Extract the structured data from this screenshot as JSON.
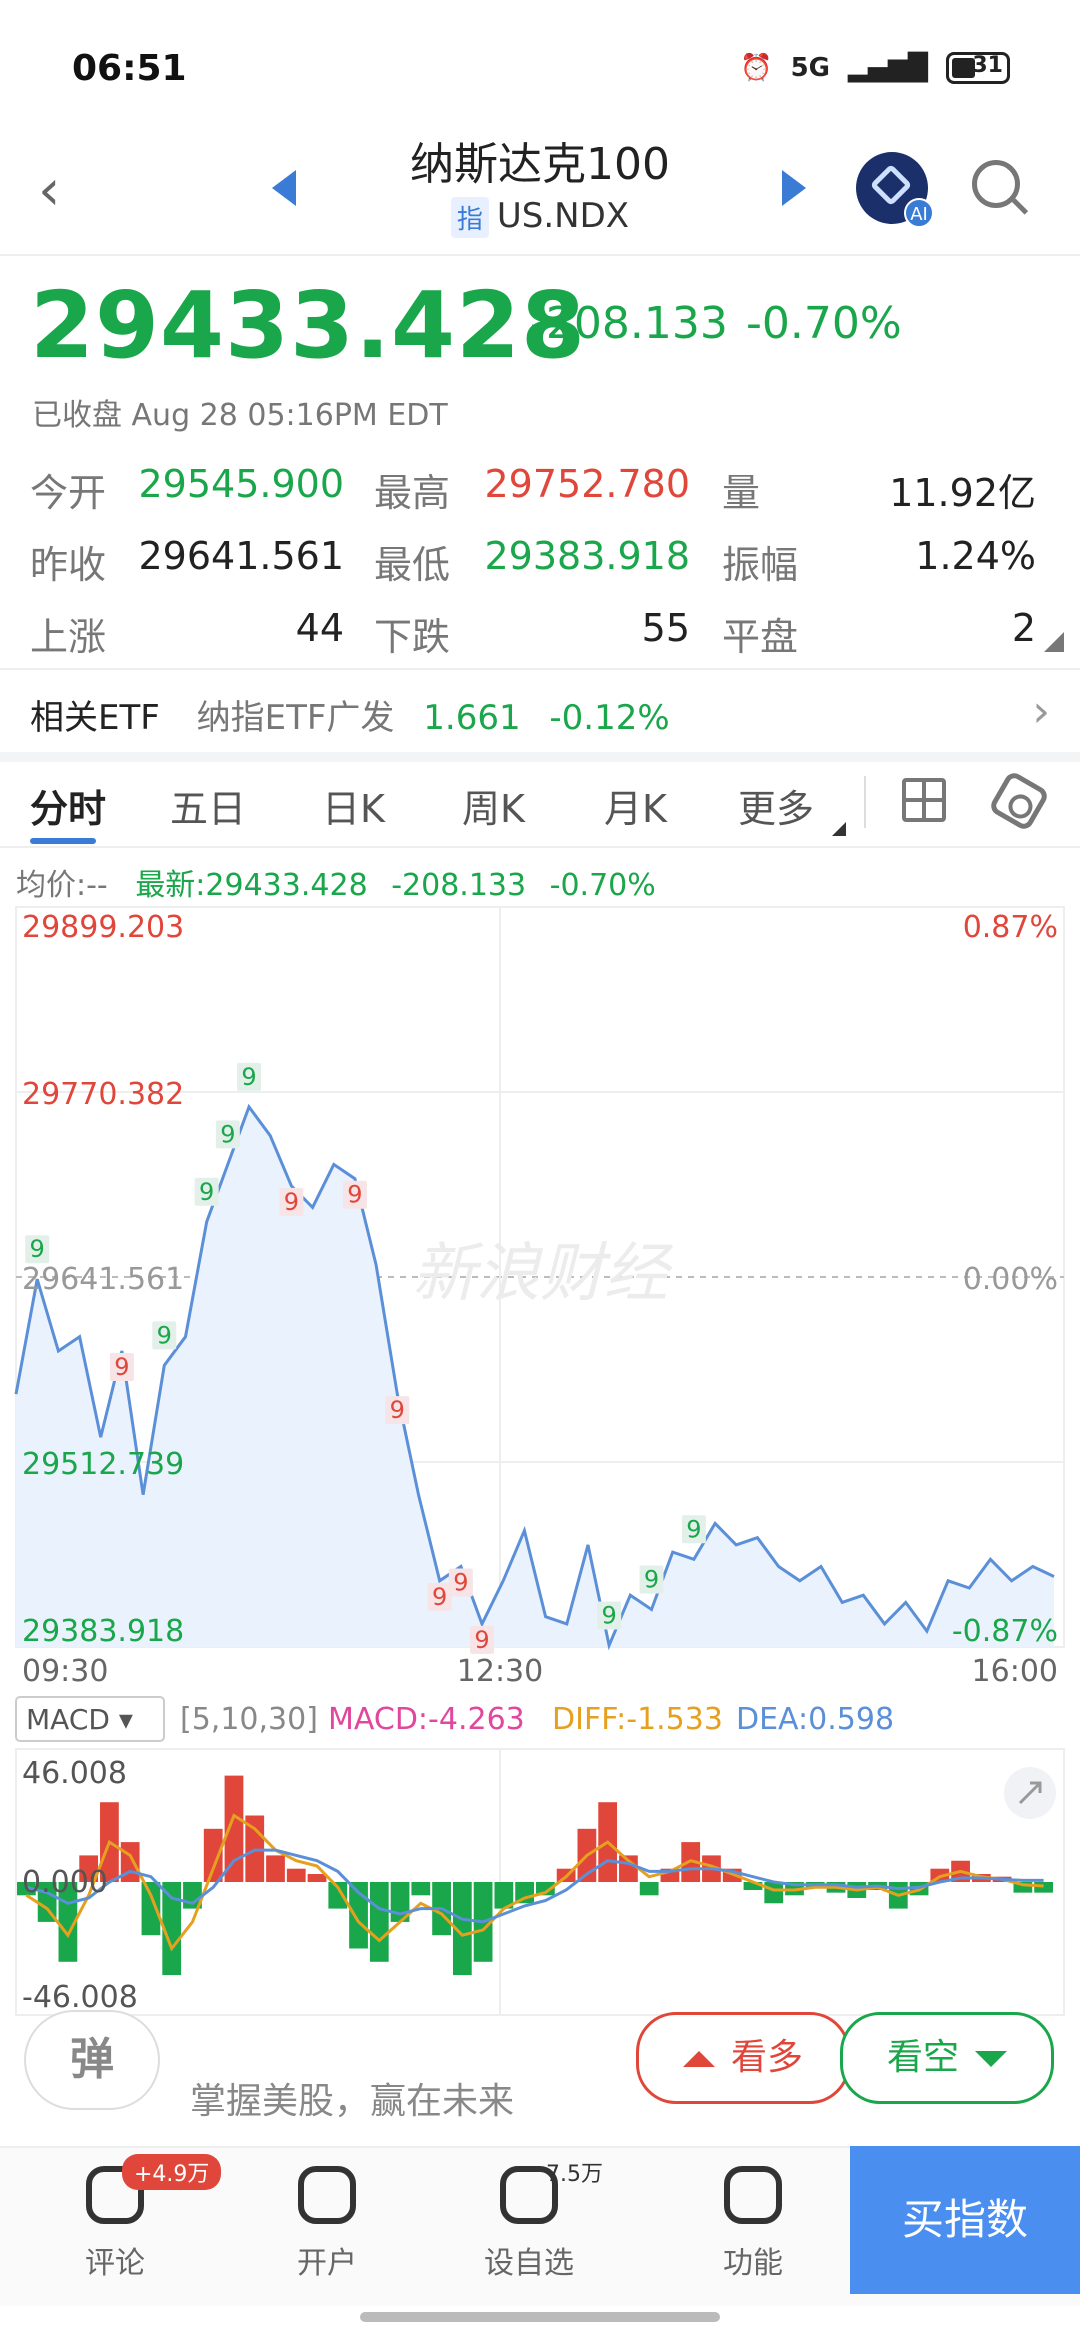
{
  "status": {
    "time": "06:51",
    "network": "5G",
    "battery": "31"
  },
  "header": {
    "title": "纳斯达克100",
    "badge": "指",
    "code": "US.NDX"
  },
  "quote": {
    "price": "29433.428",
    "change": "-208.133",
    "change_pct": "-0.70%",
    "status": "已收盘 Aug 28 05:16PM EDT"
  },
  "stats": {
    "open_label": "今开",
    "open": "29545.900",
    "high_label": "最高",
    "high": "29752.780",
    "volume_label": "量",
    "volume": "11.92亿",
    "prev_label": "昨收",
    "prev": "29641.561",
    "low_label": "最低",
    "low": "29383.918",
    "amp_label": "振幅",
    "amp": "1.24%",
    "up_label": "上涨",
    "up": "44",
    "down_label": "下跌",
    "down": "55",
    "flat_label": "平盘",
    "flat": "2"
  },
  "etf": {
    "label": "相关ETF",
    "name": "纳指ETF广发",
    "price": "1.661",
    "pct": "-0.12%"
  },
  "tabs": [
    "分时",
    "五日",
    "日K",
    "周K",
    "月K",
    "更多"
  ],
  "avg": {
    "label": "均价:--",
    "latest": "最新:29433.428",
    "change": "-208.133",
    "pct": "-0.70%"
  },
  "chart_data": [
    {
      "type": "line",
      "title": "",
      "y_labels_left": [
        "29899.203",
        "29770.382",
        "29641.561",
        "29512.739",
        "29383.918"
      ],
      "y_labels_right": [
        "0.87%",
        "0.00%",
        "-0.87%"
      ],
      "x_labels": [
        "09:30",
        "12:30",
        "16:00"
      ],
      "ylim": [
        29383.918,
        29899.203
      ],
      "watermark": "新浪财经",
      "series": [
        {
          "values": [
            29560,
            29640,
            29590,
            29600,
            29530,
            29590,
            29490,
            29580,
            29600,
            29680,
            29720,
            29760,
            29740,
            29705,
            29690,
            29720,
            29710,
            29650,
            29560,
            29490,
            29430,
            29440,
            29400,
            29430,
            29465,
            29405,
            29400,
            29455,
            29385,
            29420,
            29410,
            29450,
            29445,
            29470,
            29455,
            29460,
            29440,
            29430,
            29440,
            29415,
            29420,
            29400,
            29415,
            29395,
            29430,
            29425,
            29445,
            29430,
            29440,
            29433
          ]
        }
      ],
      "tags": [
        {
          "i": 1,
          "label": "9",
          "color": "green"
        },
        {
          "i": 5,
          "label": "9",
          "color": "red"
        },
        {
          "i": 7,
          "label": "9",
          "color": "green"
        },
        {
          "i": 9,
          "label": "9",
          "color": "green"
        },
        {
          "i": 10,
          "label": "9",
          "color": "green"
        },
        {
          "i": 11,
          "label": "9",
          "color": "green"
        },
        {
          "i": 13,
          "label": "9",
          "color": "red"
        },
        {
          "i": 16,
          "label": "9",
          "color": "red"
        },
        {
          "i": 18,
          "label": "9",
          "color": "red"
        },
        {
          "i": 20,
          "label": "9",
          "color": "red"
        },
        {
          "i": 21,
          "label": "9",
          "color": "red"
        },
        {
          "i": 22,
          "label": "9",
          "color": "red"
        },
        {
          "i": 28,
          "label": "9",
          "color": "green"
        },
        {
          "i": 30,
          "label": "9",
          "color": "green"
        },
        {
          "i": 32,
          "label": "9",
          "color": "green"
        }
      ]
    },
    {
      "type": "bar",
      "title": "MACD",
      "params": "[5,10,30]",
      "macd_label": "MACD:-4.263",
      "diff_label": "DIFF:-1.533",
      "dea_label": "DEA:0.598",
      "y_labels": [
        "46.008",
        "0.000",
        "-46.008"
      ],
      "ylim": [
        -46.008,
        46.008
      ],
      "values": [
        -5,
        -15,
        -30,
        10,
        30,
        15,
        -20,
        -35,
        -10,
        20,
        40,
        25,
        10,
        5,
        3,
        -10,
        -25,
        -30,
        -15,
        -5,
        -20,
        -35,
        -30,
        -10,
        -8,
        -5,
        5,
        20,
        30,
        10,
        -5,
        5,
        15,
        10,
        5,
        -3,
        -8,
        -5,
        -2,
        -4,
        -6,
        -3,
        -10,
        -5,
        5,
        8,
        3,
        2,
        -4,
        -4
      ],
      "diff": [
        -5,
        -10,
        -20,
        -5,
        15,
        10,
        -5,
        -25,
        -15,
        5,
        25,
        20,
        12,
        8,
        6,
        -2,
        -15,
        -22,
        -15,
        -8,
        -12,
        -20,
        -18,
        -10,
        -6,
        -4,
        2,
        10,
        15,
        8,
        2,
        4,
        8,
        6,
        3,
        0,
        -3,
        -3,
        -2,
        -2,
        -3,
        -2,
        -5,
        -3,
        2,
        4,
        2,
        1,
        -1,
        -1.5
      ],
      "dea": [
        -2,
        -4,
        -8,
        -6,
        0,
        4,
        2,
        -6,
        -8,
        -2,
        8,
        12,
        12,
        10,
        8,
        4,
        -4,
        -10,
        -12,
        -10,
        -10,
        -14,
        -15,
        -12,
        -9,
        -7,
        -3,
        3,
        8,
        7,
        4,
        4,
        5,
        5,
        4,
        2,
        0,
        -1,
        -1,
        -1,
        -2,
        -1.5,
        -2.5,
        -2,
        0,
        1.5,
        1.5,
        1,
        0.6,
        0.6
      ]
    }
  ],
  "bottom": {
    "danmu": "弹",
    "slogan": "掌握美股，赢在未来",
    "bull": "看多",
    "bear": "看空",
    "nav": [
      {
        "label": "评论",
        "badge": "+4.9万"
      },
      {
        "label": "开户"
      },
      {
        "label": "设自选",
        "badge": "7.5万"
      },
      {
        "label": "功能"
      }
    ],
    "buy": "买指数"
  },
  "colors": {
    "up": "#e0463a",
    "down": "#1aa64a",
    "accent": "#3a7bd5",
    "line": "#5b8fd8"
  }
}
